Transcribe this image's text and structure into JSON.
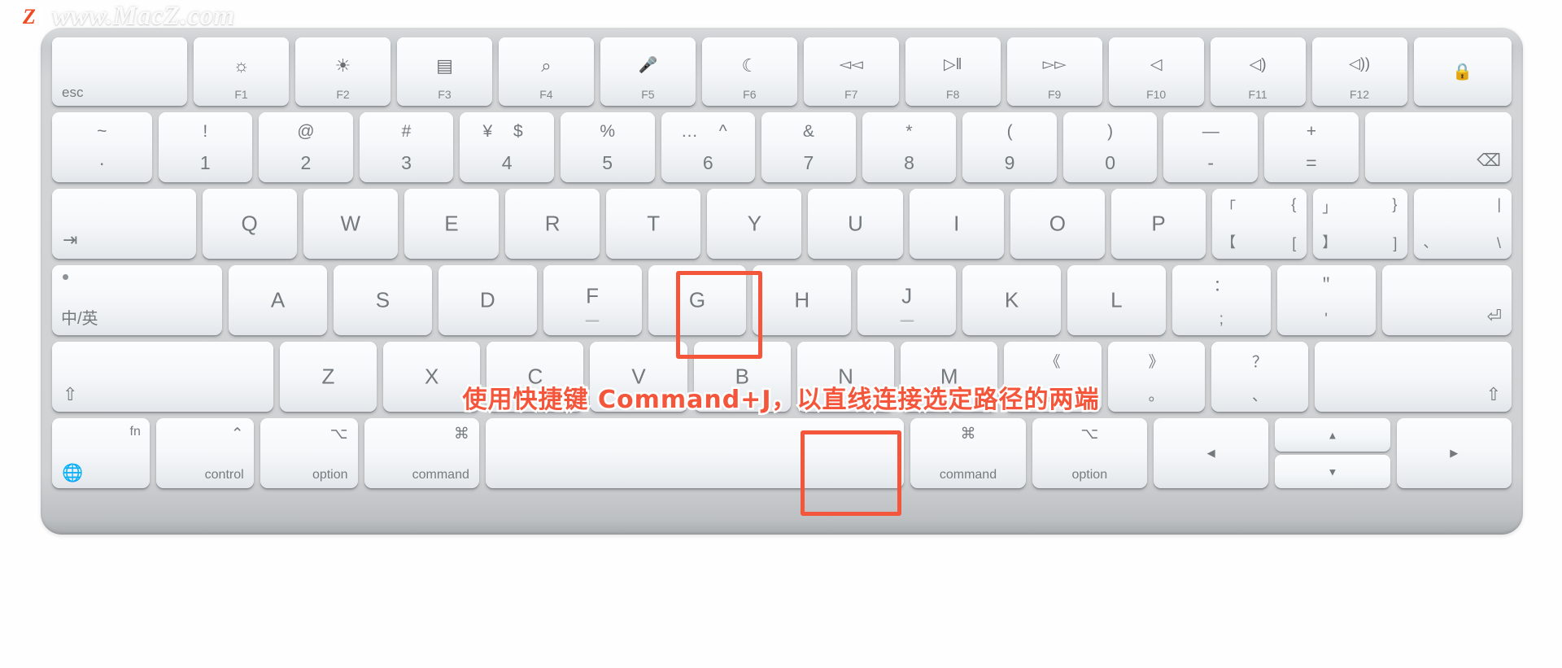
{
  "watermark": {
    "logo_letter": "Z",
    "text": "www.MacZ.com",
    "accent_color": "#f04b20"
  },
  "annotation": {
    "text": "使用快捷键 Command+J，以直线连接选定路径的两端",
    "color": "#f4563c",
    "outline_color": "#ffffff"
  },
  "highlights": [
    {
      "name": "j-key-highlight",
      "target": "J",
      "color": "#f4563c"
    },
    {
      "name": "command-key-highlight",
      "target": "command",
      "color": "#f4563c"
    }
  ],
  "keyboard": {
    "device": "Apple Magic Keyboard",
    "rows": {
      "function_row": [
        {
          "id": "esc",
          "label": "esc"
        },
        {
          "id": "f1",
          "icon": "brightness-down-icon",
          "glyph": "☼",
          "label": "F1"
        },
        {
          "id": "f2",
          "icon": "brightness-up-icon",
          "glyph": "☀",
          "label": "F2"
        },
        {
          "id": "f3",
          "icon": "mission-control-icon",
          "glyph": "▤",
          "label": "F3"
        },
        {
          "id": "f4",
          "icon": "spotlight-search-icon",
          "glyph": "⌕",
          "label": "F4"
        },
        {
          "id": "f5",
          "icon": "dictation-mic-icon",
          "glyph": "🎤",
          "label": "F5"
        },
        {
          "id": "f6",
          "icon": "do-not-disturb-moon-icon",
          "glyph": "☾",
          "label": "F6"
        },
        {
          "id": "f7",
          "icon": "rewind-icon",
          "glyph": "◅◅",
          "label": "F7"
        },
        {
          "id": "f8",
          "icon": "play-pause-icon",
          "glyph": "▷‖",
          "label": "F8"
        },
        {
          "id": "f9",
          "icon": "fast-forward-icon",
          "glyph": "▻▻",
          "label": "F9"
        },
        {
          "id": "f10",
          "icon": "mute-icon",
          "glyph": "◁",
          "label": "F10"
        },
        {
          "id": "f11",
          "icon": "volume-down-icon",
          "glyph": "◁)",
          "label": "F11"
        },
        {
          "id": "f12",
          "icon": "volume-up-icon",
          "glyph": "◁))",
          "label": "F12"
        },
        {
          "id": "lock",
          "icon": "touch-id-lock-icon",
          "glyph": "🔒",
          "label": ""
        }
      ],
      "number_row": [
        {
          "id": "tilde",
          "top": "~",
          "bottom": "·"
        },
        {
          "id": "1",
          "top": "!",
          "bottom": "1"
        },
        {
          "id": "2",
          "top": "@",
          "bottom": "2"
        },
        {
          "id": "3",
          "top": "#",
          "bottom": "3"
        },
        {
          "id": "4",
          "top": "¥ $",
          "bottom": "4",
          "dual": true
        },
        {
          "id": "5",
          "top": "%",
          "bottom": "5"
        },
        {
          "id": "6",
          "top": "… ^",
          "bottom": "6",
          "dual": true
        },
        {
          "id": "7",
          "top": "&",
          "bottom": "7"
        },
        {
          "id": "8",
          "top": "*",
          "bottom": "8"
        },
        {
          "id": "9",
          "top": "(",
          "bottom": "9"
        },
        {
          "id": "0",
          "top": ")",
          "bottom": "0"
        },
        {
          "id": "minus",
          "top": "—",
          "bottom": "-"
        },
        {
          "id": "equal",
          "top": "+",
          "bottom": "="
        },
        {
          "id": "delete",
          "icon": "delete-backspace-icon",
          "glyph": "⌫"
        }
      ],
      "qwerty_row": [
        {
          "id": "tab",
          "icon": "tab-arrow-icon",
          "glyph": "⇥"
        },
        {
          "id": "q",
          "label": "Q"
        },
        {
          "id": "w",
          "label": "W"
        },
        {
          "id": "e",
          "label": "E"
        },
        {
          "id": "r",
          "label": "R"
        },
        {
          "id": "t",
          "label": "T"
        },
        {
          "id": "y",
          "label": "Y"
        },
        {
          "id": "u",
          "label": "U"
        },
        {
          "id": "i",
          "label": "I"
        },
        {
          "id": "o",
          "label": "O"
        },
        {
          "id": "p",
          "label": "P"
        },
        {
          "id": "lbracket",
          "tl": "「",
          "tr": "{",
          "bl": "【",
          "br": "["
        },
        {
          "id": "rbracket",
          "tl": "」",
          "tr": "}",
          "bl": "】",
          "br": "]"
        },
        {
          "id": "backslash",
          "top": "|",
          "bottom_cjk": "、",
          "bottom": "\\"
        }
      ],
      "home_row": [
        {
          "id": "capslock",
          "icon": "caps-lock-dot-icon",
          "label": "中/英"
        },
        {
          "id": "a",
          "label": "A"
        },
        {
          "id": "s",
          "label": "S"
        },
        {
          "id": "d",
          "label": "D"
        },
        {
          "id": "f",
          "label": "F",
          "homing": true
        },
        {
          "id": "g",
          "label": "G"
        },
        {
          "id": "h",
          "label": "H"
        },
        {
          "id": "j",
          "label": "J",
          "homing": true,
          "highlighted": true
        },
        {
          "id": "k",
          "label": "K"
        },
        {
          "id": "l",
          "label": "L"
        },
        {
          "id": "semicolon",
          "top": "：",
          "bottom": ";"
        },
        {
          "id": "quote",
          "top": "＂",
          "bottom": "'"
        },
        {
          "id": "return",
          "icon": "return-arrow-icon",
          "glyph": "⏎"
        }
      ],
      "shift_row": [
        {
          "id": "lshift",
          "icon": "shift-arrow-icon",
          "glyph": "⇧"
        },
        {
          "id": "z",
          "label": "Z"
        },
        {
          "id": "x",
          "label": "X"
        },
        {
          "id": "c",
          "label": "C"
        },
        {
          "id": "v",
          "label": "V"
        },
        {
          "id": "b",
          "label": "B"
        },
        {
          "id": "n",
          "label": "N"
        },
        {
          "id": "m",
          "label": "M"
        },
        {
          "id": "comma",
          "top": "《",
          "bottom": "，"
        },
        {
          "id": "period",
          "top": "》",
          "bottom": "。"
        },
        {
          "id": "slash",
          "top": "？",
          "bottom": "、"
        },
        {
          "id": "rshift",
          "icon": "shift-arrow-icon",
          "glyph": "⇧"
        }
      ],
      "bottom_row": [
        {
          "id": "fn",
          "label": "fn",
          "icon": "globe-icon",
          "glyph": "🌐"
        },
        {
          "id": "control",
          "label": "control",
          "icon": "control-caret-icon",
          "glyph": "⌃"
        },
        {
          "id": "loption",
          "label": "option",
          "icon": "option-icon",
          "glyph": "⌥"
        },
        {
          "id": "lcommand",
          "label": "command",
          "icon": "command-icon",
          "glyph": "⌘"
        },
        {
          "id": "space",
          "label": ""
        },
        {
          "id": "rcommand",
          "label": "command",
          "icon": "command-icon",
          "glyph": "⌘",
          "highlighted": true
        },
        {
          "id": "roption",
          "label": "option",
          "icon": "option-icon",
          "glyph": "⌥"
        },
        {
          "id": "left",
          "icon": "arrow-left-icon",
          "glyph": "◀"
        },
        {
          "id": "up",
          "icon": "arrow-up-icon",
          "glyph": "▲"
        },
        {
          "id": "down",
          "icon": "arrow-down-icon",
          "glyph": "▼"
        },
        {
          "id": "right",
          "icon": "arrow-right-icon",
          "glyph": "▶"
        }
      ]
    }
  }
}
